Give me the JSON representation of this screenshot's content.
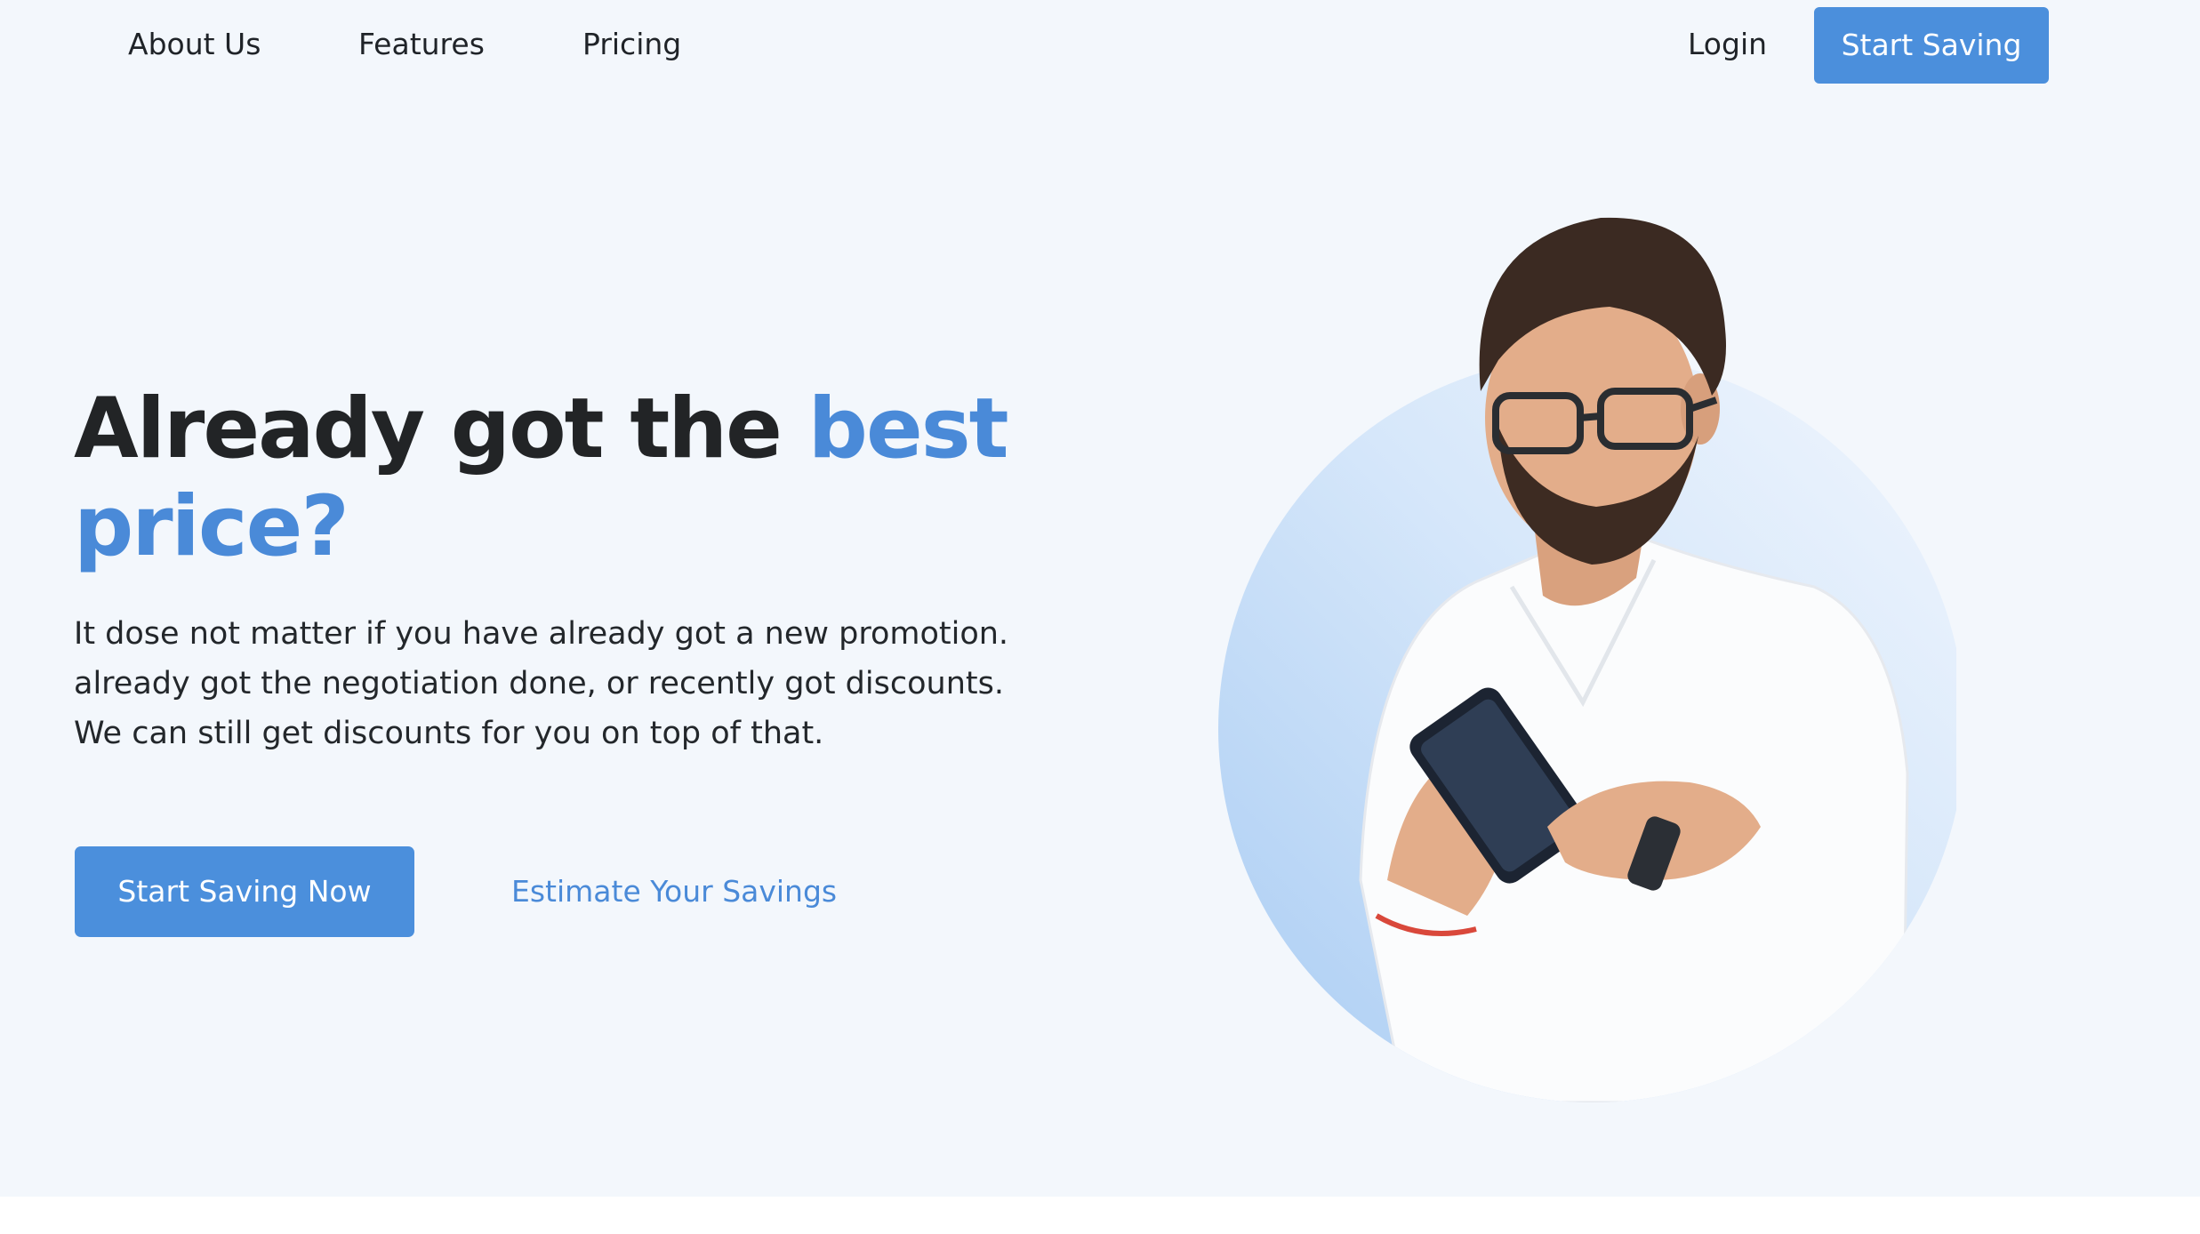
{
  "nav": {
    "links": [
      {
        "label": "About Us"
      },
      {
        "label": "Features"
      },
      {
        "label": "Pricing"
      }
    ],
    "login_label": "Login",
    "cta_label": "Start Saving"
  },
  "hero": {
    "title_part1": "Already got the ",
    "title_accent": "best price?",
    "body": "It dose not matter if you have already got a new promotion. already got the negotiation done, or recently got discounts. We can still get discounts for you on top of that.",
    "primary_button": "Start Saving Now",
    "secondary_link": "Estimate Your Savings"
  },
  "colors": {
    "accent": "#4b8fdc",
    "background": "#f3f7fc",
    "text": "#222426"
  },
  "icons": {
    "hero_image": "man-using-phone-illustration"
  }
}
